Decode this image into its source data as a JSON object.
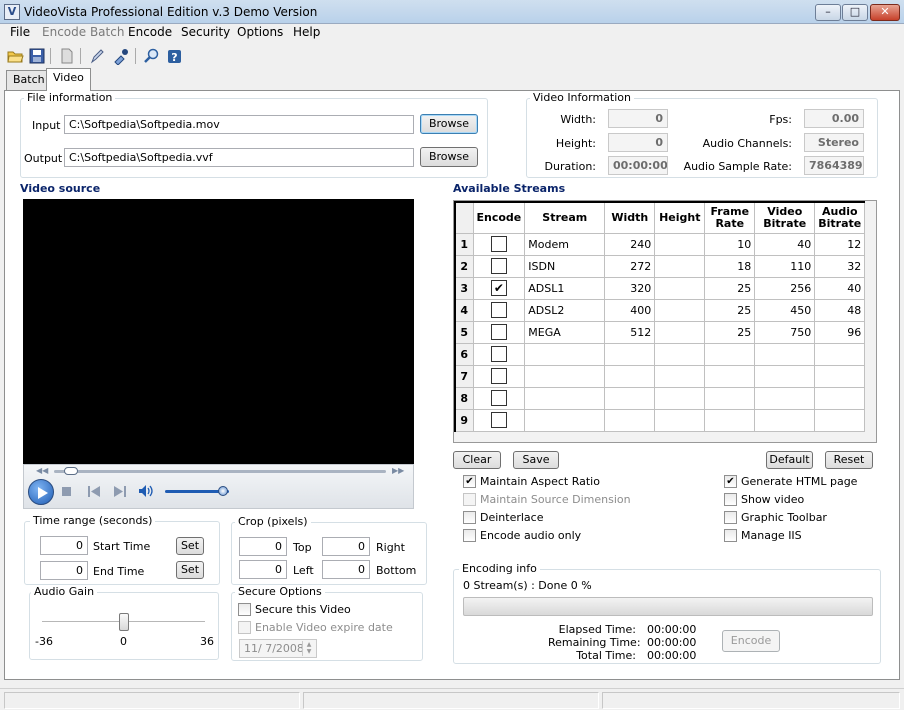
{
  "window": {
    "title": "VideoVista Professional Edition v.3 Demo Version",
    "icon_letter": "V",
    "minimize": "–",
    "maximize": "□",
    "close": "✕"
  },
  "menu": [
    "File",
    "Encode Batch",
    "Encode",
    "Security",
    "Options",
    "Help"
  ],
  "toolbar": [
    "open-icon",
    "save-icon",
    "document-icon",
    "pen-icon",
    "pipette-icon",
    "zoom-icon",
    "help-icon"
  ],
  "tabs": [
    "Batch",
    "Video"
  ],
  "file_info": {
    "title": "File information",
    "input_label": "Input",
    "input_value": "C:\\Softpedia\\Softpedia.mov",
    "output_label": "Output",
    "output_value": "C:\\Softpedia\\Softpedia.vvf",
    "browse": "Browse"
  },
  "video_info": {
    "title": "Video Information",
    "width_label": "Width:",
    "width": "0",
    "height_label": "Height:",
    "height": "0",
    "duration_label": "Duration:",
    "duration": "00:00:00",
    "fps_label": "Fps:",
    "fps": "0.00",
    "channels_label": "Audio Channels:",
    "channels": "Stereo",
    "rate_label": "Audio Sample Rate:",
    "rate": "7864389"
  },
  "video_source": {
    "title": "Video source",
    "seek_fraction": 0.03,
    "volume_fraction": 0.99
  },
  "streams": {
    "title": "Available Streams",
    "headers": [
      "Encode",
      "Stream",
      "Width",
      "Height",
      "Frame Rate",
      "Video Bitrate",
      "Audio Bitrate"
    ],
    "rows": [
      {
        "n": "1",
        "checked": false,
        "stream": "Modem",
        "width": "240",
        "height": "",
        "fr": "10",
        "vb": "40",
        "ab": "12"
      },
      {
        "n": "2",
        "checked": false,
        "stream": "ISDN",
        "width": "272",
        "height": "",
        "fr": "18",
        "vb": "110",
        "ab": "32"
      },
      {
        "n": "3",
        "checked": true,
        "stream": "ADSL1",
        "width": "320",
        "height": "",
        "fr": "25",
        "vb": "256",
        "ab": "40"
      },
      {
        "n": "4",
        "checked": false,
        "stream": "ADSL2",
        "width": "400",
        "height": "",
        "fr": "25",
        "vb": "450",
        "ab": "48"
      },
      {
        "n": "5",
        "checked": false,
        "stream": "MEGA",
        "width": "512",
        "height": "",
        "fr": "25",
        "vb": "750",
        "ab": "96"
      },
      {
        "n": "6",
        "checked": false,
        "stream": "",
        "width": "",
        "height": "",
        "fr": "",
        "vb": "",
        "ab": ""
      },
      {
        "n": "7",
        "checked": false,
        "stream": "",
        "width": "",
        "height": "",
        "fr": "",
        "vb": "",
        "ab": ""
      },
      {
        "n": "8",
        "checked": false,
        "stream": "",
        "width": "",
        "height": "",
        "fr": "",
        "vb": "",
        "ab": ""
      },
      {
        "n": "9",
        "checked": false,
        "stream": "",
        "width": "",
        "height": "",
        "fr": "",
        "vb": "",
        "ab": ""
      }
    ],
    "clear": "Clear",
    "save": "Save",
    "default": "Default",
    "reset": "Reset"
  },
  "options_left": [
    {
      "label": "Maintain Aspect Ratio",
      "checked": true,
      "enabled": true
    },
    {
      "label": "Maintain Source Dimension",
      "checked": false,
      "enabled": false
    },
    {
      "label": "Deinterlace",
      "checked": false,
      "enabled": true
    },
    {
      "label": "Encode audio only",
      "checked": false,
      "enabled": true
    }
  ],
  "options_right": [
    {
      "label": "Generate HTML page",
      "checked": true,
      "enabled": true
    },
    {
      "label": "Show video",
      "checked": false,
      "enabled": true
    },
    {
      "label": "Graphic Toolbar",
      "checked": false,
      "enabled": true
    },
    {
      "label": "Manage IIS",
      "checked": false,
      "enabled": true
    }
  ],
  "time_range": {
    "title": "Time range (seconds)",
    "start_value": "0",
    "start_label": "Start Time",
    "end_value": "0",
    "end_label": "End Time",
    "set": "Set"
  },
  "crop": {
    "title": "Crop (pixels)",
    "top": "0",
    "top_label": "Top",
    "right": "0",
    "right_label": "Right",
    "left": "0",
    "left_label": "Left",
    "bottom": "0",
    "bottom_label": "Bottom"
  },
  "audio_gain": {
    "title": "Audio Gain",
    "min": "-36",
    "mid": "0",
    "max": "36",
    "value": 0
  },
  "secure": {
    "title": "Secure Options",
    "secure_label": "Secure this Video",
    "secure_checked": false,
    "expire_label": "Enable Video expire date",
    "expire_checked": false,
    "date": "11/  7/2008"
  },
  "encoding": {
    "title": "Encoding info",
    "status": "0 Stream(s) : Done 0 %",
    "progress": 0,
    "elapsed_label": "Elapsed Time:",
    "elapsed": "00:00:00",
    "remaining_label": "Remaining Time:",
    "remaining": "00:00:00",
    "total_label": "Total Time:",
    "total": "00:00:00",
    "encode": "Encode"
  }
}
